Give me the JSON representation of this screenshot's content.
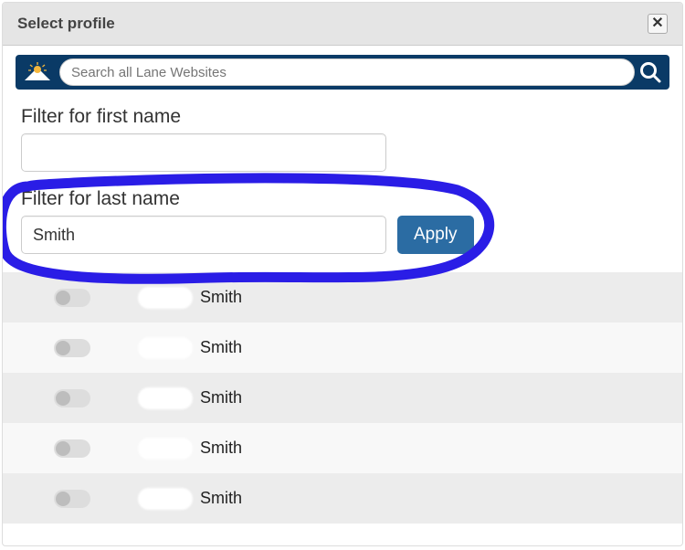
{
  "dialog": {
    "title": "Select profile"
  },
  "search": {
    "placeholder": "Search all Lane Websites"
  },
  "filters": {
    "first_name_label": "Filter for first name",
    "first_name_value": "",
    "last_name_label": "Filter for last name",
    "last_name_value": "Smith",
    "apply_label": "Apply"
  },
  "colors": {
    "annotation": "#2a1de6",
    "searchbar_bg": "#0a3a66",
    "apply_bg": "#2b6ca3"
  },
  "results": [
    {
      "last_name": "Smith"
    },
    {
      "last_name": "Smith"
    },
    {
      "last_name": "Smith"
    },
    {
      "last_name": "Smith"
    },
    {
      "last_name": "Smith"
    }
  ]
}
